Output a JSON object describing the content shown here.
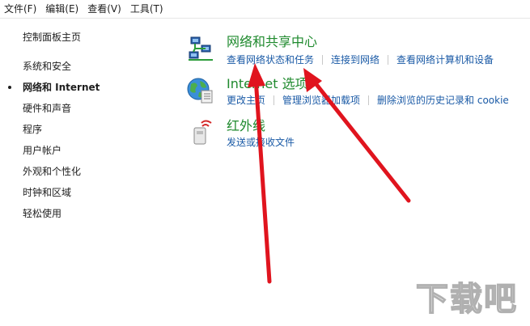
{
  "menubar": {
    "items": [
      "文件(F)",
      "编辑(E)",
      "查看(V)",
      "工具(T)"
    ]
  },
  "sidebar": {
    "home_label": "控制面板主页",
    "items": [
      {
        "label": "系统和安全",
        "active": false
      },
      {
        "label": "网络和 Internet",
        "active": true
      },
      {
        "label": "硬件和声音",
        "active": false
      },
      {
        "label": "程序",
        "active": false
      },
      {
        "label": "用户帐户",
        "active": false
      },
      {
        "label": "外观和个性化",
        "active": false
      },
      {
        "label": "时钟和区域",
        "active": false
      },
      {
        "label": "轻松使用",
        "active": false
      }
    ]
  },
  "sections": [
    {
      "title": "网络和共享中心",
      "icon": "network-sharing-center-icon",
      "links": [
        "查看网络状态和任务",
        "连接到网络",
        "查看网络计算机和设备"
      ]
    },
    {
      "title": "Internet 选项",
      "icon": "internet-options-globe-icon",
      "links": [
        "更改主页",
        "管理浏览器加载项",
        "删除浏览的历史记录和 cookie"
      ]
    },
    {
      "title": "红外线",
      "icon": "infrared-icon",
      "links": [
        "发送或接收文件"
      ]
    }
  ],
  "colors": {
    "section_title": "#1f8a2e",
    "link": "#1a5aa6",
    "annotation_arrow": "#e0141e"
  },
  "watermark": {
    "text": "下载吧"
  }
}
